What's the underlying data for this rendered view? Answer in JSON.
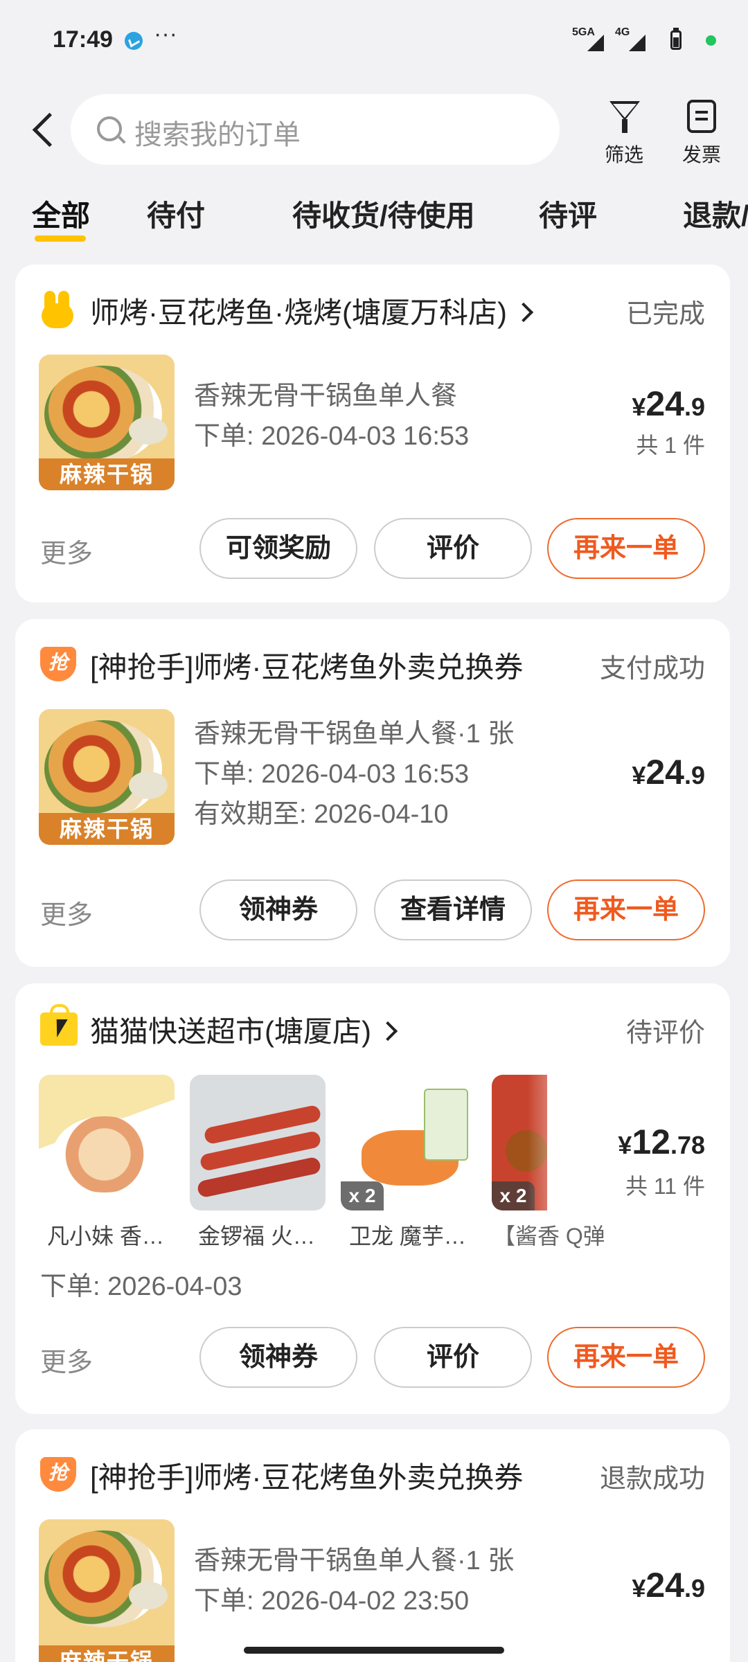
{
  "status_bar": {
    "time": "17:49",
    "dots": "···",
    "net1": "5GA",
    "net2": "4G"
  },
  "header": {
    "search_placeholder": "搜索我的订单",
    "filter_label": "筛选",
    "invoice_label": "发票"
  },
  "tabs": [
    {
      "label": "全部",
      "active": true
    },
    {
      "label": "待付"
    },
    {
      "label": "待收货/待使用"
    },
    {
      "label": "待评"
    },
    {
      "label": "退款/"
    }
  ],
  "orders": [
    {
      "shop": "师烤·豆花烤鱼·烧烤(塘厦万科店)",
      "status": "已完成",
      "item_title": "香辣无骨干锅鱼单人餐",
      "order_time": "下单: 2026-04-03 16:53",
      "price_symbol": "¥",
      "price_int": "24",
      "price_dec": ".9",
      "count": "共 1 件",
      "image_tag": "麻辣干锅",
      "more": "更多",
      "buttons": [
        "可领奖励",
        "评价",
        "再来一单"
      ]
    },
    {
      "shop": "[神抢手]师烤·豆花烤鱼外卖兑换券",
      "status": "支付成功",
      "item_title": "香辣无骨干锅鱼单人餐·1 张",
      "order_time": "下单: 2026-04-03 16:53",
      "valid_until": "有效期至: 2026-04-10",
      "price_symbol": "¥",
      "price_int": "24",
      "price_dec": ".9",
      "image_tag": "麻辣干锅",
      "more": "更多",
      "buttons": [
        "领神券",
        "查看详情",
        "再来一单"
      ]
    },
    {
      "shop": "猫猫快送超市(塘厦店)",
      "status": "待评价",
      "thumbs": [
        {
          "label": "凡小妹 香…",
          "qty": ""
        },
        {
          "label": "金锣福 火…",
          "qty": ""
        },
        {
          "label": "卫龙 魔芋…",
          "qty": "x 2"
        },
        {
          "label": "【酱香 Q弹",
          "qty": "x 2"
        }
      ],
      "order_time": "下单: 2026-04-03",
      "price_symbol": "¥",
      "price_int": "12",
      "price_dec": ".78",
      "count": "共 11 件",
      "more": "更多",
      "buttons": [
        "领神券",
        "评价",
        "再来一单"
      ]
    },
    {
      "shop": "[神抢手]师烤·豆花烤鱼外卖兑换券",
      "status": "退款成功",
      "item_title": "香辣无骨干锅鱼单人餐·1 张",
      "order_time": "下单: 2026-04-02 23:50",
      "price_symbol": "¥",
      "price_int": "24",
      "price_dec": ".9",
      "image_tag": "麻辣干锅"
    }
  ],
  "colors": {
    "accent": "#ef5a1f",
    "tab_underline": "#ffc300",
    "background": "#f2f2f4"
  }
}
